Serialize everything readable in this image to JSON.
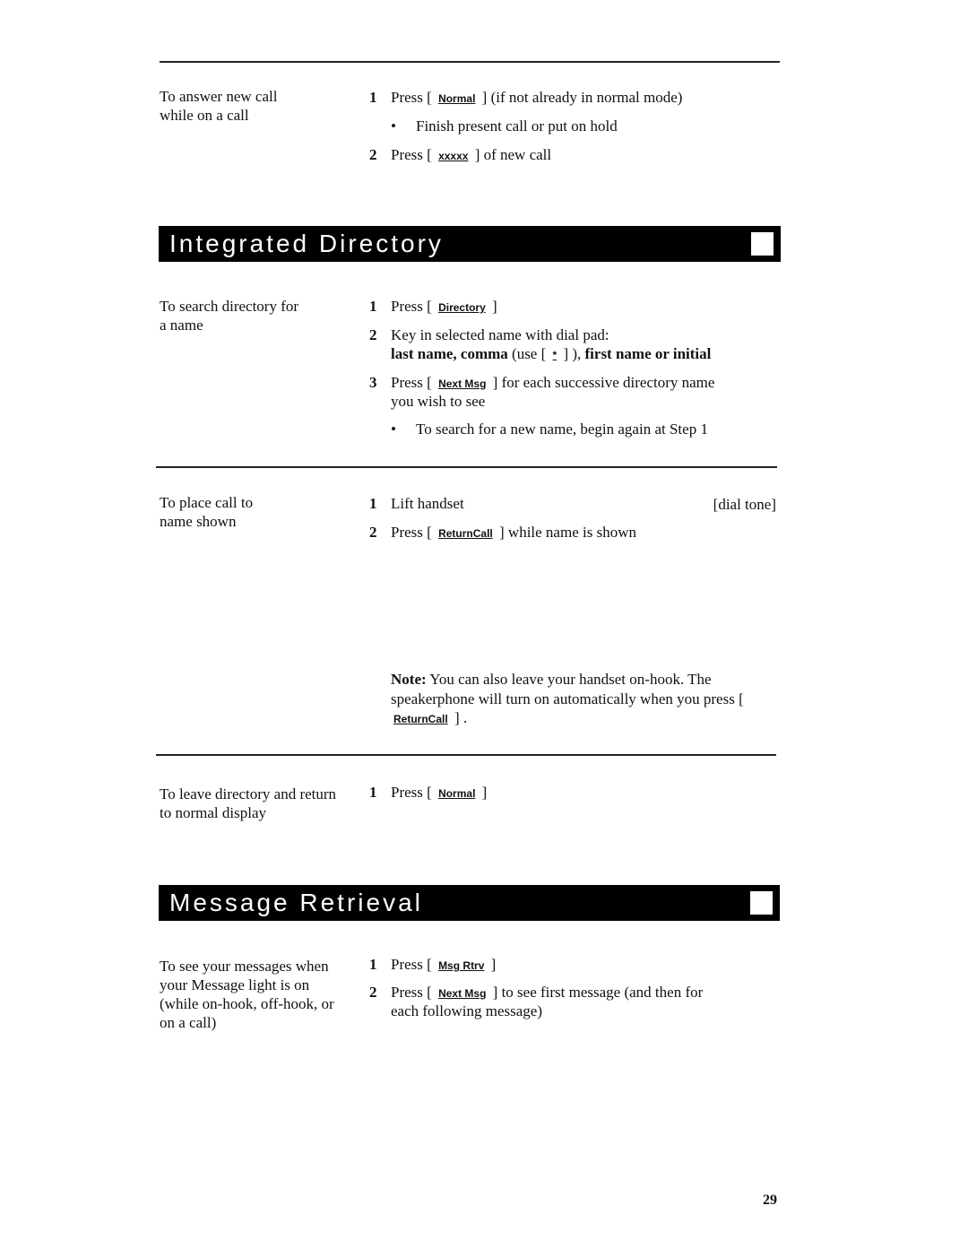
{
  "page_number": "29",
  "sections": {
    "answer_new_call": {
      "label": "To answer new call while on a call",
      "step1_num": "1",
      "step1_pre": "Press [",
      "step1_key": "Normal",
      "step1_post": "] (if not already in normal mode)",
      "bullet1_mark": "•",
      "bullet1": "Finish present call or put on hold",
      "step2_num": "2",
      "step2_pre": "Press [",
      "step2_key": "xxxxx",
      "step2_post": "] of new call"
    },
    "integrated_directory": {
      "title": "Integrated Directory",
      "search": {
        "label": "To search directory for a name",
        "step1_num": "1",
        "step1_pre": "Press [",
        "step1_key": "Directory",
        "step1_post": "]",
        "step2_num": "2",
        "step2_text": "Key in selected name with dial pad:",
        "step2_bold1": "last name, comma",
        "step2_mid_pre": "(use [",
        "step2_key": "*",
        "step2_mid_post": "] ),",
        "step2_bold2": "first name or initial",
        "step3_num": "3",
        "step3_pre": "Press [",
        "step3_key": "Next Msg",
        "step3_post": "] for each successive directory name",
        "step3_cont": "you wish to see",
        "bullet_mark": "•",
        "bullet": "To search for a new name, begin again at Step 1"
      },
      "place_call": {
        "label": "To place call to name shown",
        "step1_num": "1",
        "step1_text": "Lift handset",
        "step1_note": "[dial tone]",
        "step2_num": "2",
        "step2_pre": "Press [",
        "step2_key": "ReturnCall",
        "step2_post": "] while name is shown",
        "note_label": "Note:",
        "note_text1": "You can also leave your handset on-hook. The speakerphone will turn on automatically when you press [",
        "note_key": "ReturnCall",
        "note_text2": "] ."
      },
      "leave": {
        "label": "To leave directory and return to normal display",
        "step1_num": "1",
        "step1_pre": "Press [",
        "step1_key": "Normal",
        "step1_post": "]"
      }
    },
    "message_retrieval": {
      "title": "Message Retrieval",
      "see_messages": {
        "label": "To see your messages when your Message light is on (while on-hook, off-hook, or on a call)",
        "step1_num": "1",
        "step1_pre": "Press [",
        "step1_key": "Msg Rtrv",
        "step1_post": "]",
        "step2_num": "2",
        "step2_pre": "Press [",
        "step2_key": "Next Msg",
        "step2_post": "] to see first message (and then for",
        "step2_cont": "each following message)"
      }
    }
  }
}
